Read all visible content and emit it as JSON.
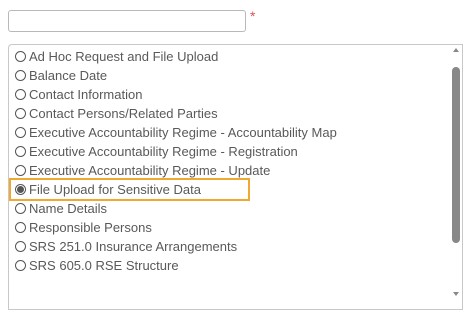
{
  "input": {
    "value": "",
    "required_mark": "*"
  },
  "list": {
    "options": [
      {
        "label": "Ad Hoc Request and File Upload",
        "selected": false
      },
      {
        "label": "Balance Date",
        "selected": false
      },
      {
        "label": "Contact Information",
        "selected": false
      },
      {
        "label": "Contact Persons/Related Parties",
        "selected": false
      },
      {
        "label": "Executive Accountability Regime - Accountability Map",
        "selected": false
      },
      {
        "label": "Executive Accountability Regime - Registration",
        "selected": false
      },
      {
        "label": "Executive Accountability Regime - Update",
        "selected": false
      },
      {
        "label": "File Upload for Sensitive Data",
        "selected": true
      },
      {
        "label": "Name Details",
        "selected": false
      },
      {
        "label": "Responsible Persons",
        "selected": false
      },
      {
        "label": "SRS 251.0 Insurance Arrangements",
        "selected": false
      },
      {
        "label": "SRS 605.0 RSE Structure",
        "selected": false
      }
    ]
  },
  "colors": {
    "highlight": "#f0a830",
    "required": "#d9534f"
  }
}
